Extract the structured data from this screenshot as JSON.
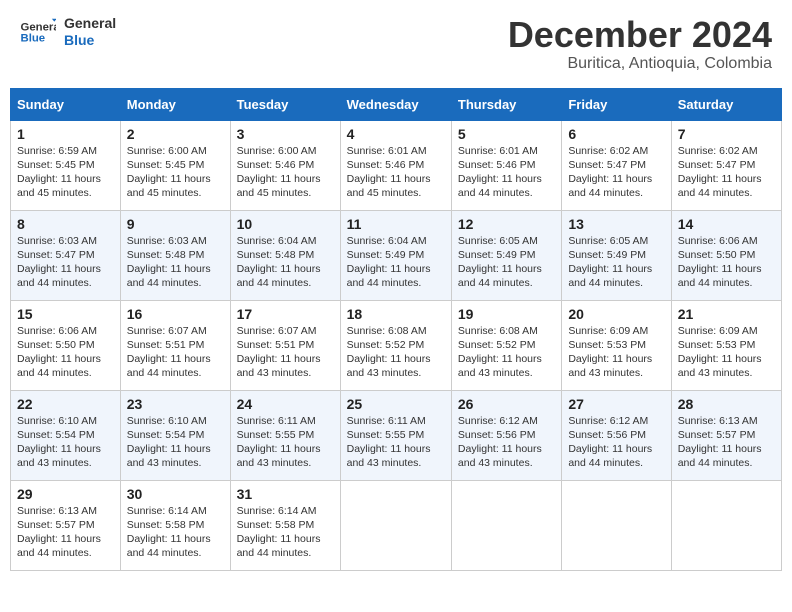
{
  "logo": {
    "line1": "General",
    "line2": "Blue"
  },
  "title": "December 2024",
  "location": "Buritica, Antioquia, Colombia",
  "header": {
    "days": [
      "Sunday",
      "Monday",
      "Tuesday",
      "Wednesday",
      "Thursday",
      "Friday",
      "Saturday"
    ]
  },
  "weeks": [
    [
      {
        "day": "1",
        "sunrise": "6:59 AM",
        "sunset": "5:45 PM",
        "daylight": "11 hours and 45 minutes."
      },
      {
        "day": "2",
        "sunrise": "6:00 AM",
        "sunset": "5:45 PM",
        "daylight": "11 hours and 45 minutes."
      },
      {
        "day": "3",
        "sunrise": "6:00 AM",
        "sunset": "5:46 PM",
        "daylight": "11 hours and 45 minutes."
      },
      {
        "day": "4",
        "sunrise": "6:01 AM",
        "sunset": "5:46 PM",
        "daylight": "11 hours and 45 minutes."
      },
      {
        "day": "5",
        "sunrise": "6:01 AM",
        "sunset": "5:46 PM",
        "daylight": "11 hours and 44 minutes."
      },
      {
        "day": "6",
        "sunrise": "6:02 AM",
        "sunset": "5:47 PM",
        "daylight": "11 hours and 44 minutes."
      },
      {
        "day": "7",
        "sunrise": "6:02 AM",
        "sunset": "5:47 PM",
        "daylight": "11 hours and 44 minutes."
      }
    ],
    [
      {
        "day": "8",
        "sunrise": "6:03 AM",
        "sunset": "5:47 PM",
        "daylight": "11 hours and 44 minutes."
      },
      {
        "day": "9",
        "sunrise": "6:03 AM",
        "sunset": "5:48 PM",
        "daylight": "11 hours and 44 minutes."
      },
      {
        "day": "10",
        "sunrise": "6:04 AM",
        "sunset": "5:48 PM",
        "daylight": "11 hours and 44 minutes."
      },
      {
        "day": "11",
        "sunrise": "6:04 AM",
        "sunset": "5:49 PM",
        "daylight": "11 hours and 44 minutes."
      },
      {
        "day": "12",
        "sunrise": "6:05 AM",
        "sunset": "5:49 PM",
        "daylight": "11 hours and 44 minutes."
      },
      {
        "day": "13",
        "sunrise": "6:05 AM",
        "sunset": "5:49 PM",
        "daylight": "11 hours and 44 minutes."
      },
      {
        "day": "14",
        "sunrise": "6:06 AM",
        "sunset": "5:50 PM",
        "daylight": "11 hours and 44 minutes."
      }
    ],
    [
      {
        "day": "15",
        "sunrise": "6:06 AM",
        "sunset": "5:50 PM",
        "daylight": "11 hours and 44 minutes."
      },
      {
        "day": "16",
        "sunrise": "6:07 AM",
        "sunset": "5:51 PM",
        "daylight": "11 hours and 44 minutes."
      },
      {
        "day": "17",
        "sunrise": "6:07 AM",
        "sunset": "5:51 PM",
        "daylight": "11 hours and 43 minutes."
      },
      {
        "day": "18",
        "sunrise": "6:08 AM",
        "sunset": "5:52 PM",
        "daylight": "11 hours and 43 minutes."
      },
      {
        "day": "19",
        "sunrise": "6:08 AM",
        "sunset": "5:52 PM",
        "daylight": "11 hours and 43 minutes."
      },
      {
        "day": "20",
        "sunrise": "6:09 AM",
        "sunset": "5:53 PM",
        "daylight": "11 hours and 43 minutes."
      },
      {
        "day": "21",
        "sunrise": "6:09 AM",
        "sunset": "5:53 PM",
        "daylight": "11 hours and 43 minutes."
      }
    ],
    [
      {
        "day": "22",
        "sunrise": "6:10 AM",
        "sunset": "5:54 PM",
        "daylight": "11 hours and 43 minutes."
      },
      {
        "day": "23",
        "sunrise": "6:10 AM",
        "sunset": "5:54 PM",
        "daylight": "11 hours and 43 minutes."
      },
      {
        "day": "24",
        "sunrise": "6:11 AM",
        "sunset": "5:55 PM",
        "daylight": "11 hours and 43 minutes."
      },
      {
        "day": "25",
        "sunrise": "6:11 AM",
        "sunset": "5:55 PM",
        "daylight": "11 hours and 43 minutes."
      },
      {
        "day": "26",
        "sunrise": "6:12 AM",
        "sunset": "5:56 PM",
        "daylight": "11 hours and 43 minutes."
      },
      {
        "day": "27",
        "sunrise": "6:12 AM",
        "sunset": "5:56 PM",
        "daylight": "11 hours and 44 minutes."
      },
      {
        "day": "28",
        "sunrise": "6:13 AM",
        "sunset": "5:57 PM",
        "daylight": "11 hours and 44 minutes."
      }
    ],
    [
      {
        "day": "29",
        "sunrise": "6:13 AM",
        "sunset": "5:57 PM",
        "daylight": "11 hours and 44 minutes."
      },
      {
        "day": "30",
        "sunrise": "6:14 AM",
        "sunset": "5:58 PM",
        "daylight": "11 hours and 44 minutes."
      },
      {
        "day": "31",
        "sunrise": "6:14 AM",
        "sunset": "5:58 PM",
        "daylight": "11 hours and 44 minutes."
      },
      null,
      null,
      null,
      null
    ]
  ],
  "labels": {
    "sunrise_prefix": "Sunrise: ",
    "sunset_prefix": "Sunset: ",
    "daylight_prefix": "Daylight: "
  }
}
